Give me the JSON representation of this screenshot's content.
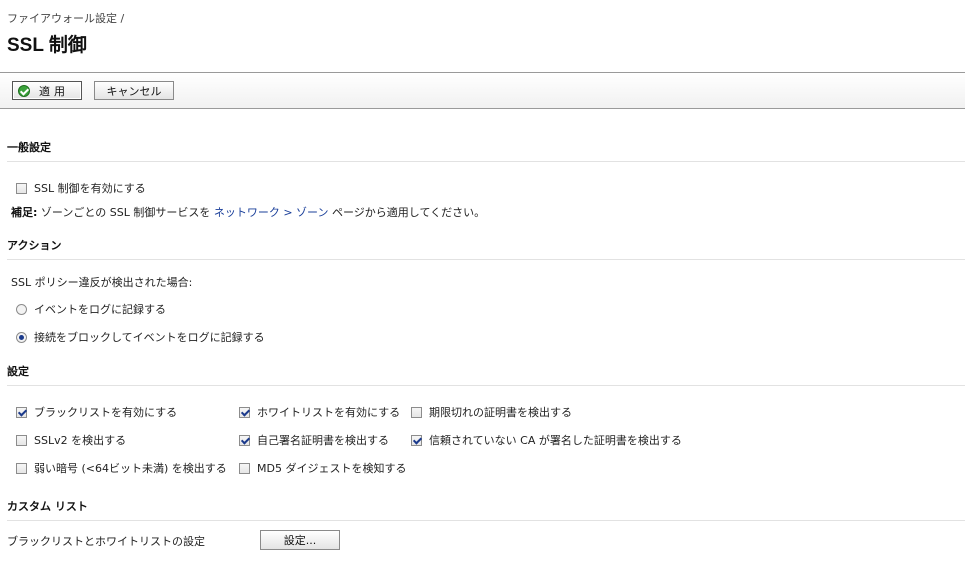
{
  "breadcrumb": "ファイアウォール設定 /",
  "page_title": "SSL 制御",
  "toolbar": {
    "apply_label": "適用",
    "cancel_label": "キャンセル"
  },
  "general": {
    "heading": "一般設定",
    "enable_ssl_label": "SSL 制御を有効にする",
    "enable_ssl_checked": false,
    "note_prefix": "補足:",
    "note_text_1": " ゾーンごとの SSL 制御サービスを ",
    "note_link": "ネットワーク > ゾーン",
    "note_text_2": " ページから適用してください。"
  },
  "action": {
    "heading": "アクション",
    "intro": "SSL ポリシー違反が検出された場合:",
    "options": [
      {
        "label": "イベントをログに記録する",
        "checked": false
      },
      {
        "label": "接続をブロックしてイベントをログに記録する",
        "checked": true
      }
    ]
  },
  "settings": {
    "heading": "設定",
    "checkboxes": [
      {
        "label": "ブラックリストを有効にする",
        "checked": true
      },
      {
        "label": "ホワイトリストを有効にする",
        "checked": true
      },
      {
        "label": "期限切れの証明書を検出する",
        "checked": false
      },
      {
        "label": "SSLv2 を検出する",
        "checked": false
      },
      {
        "label": "自己署名証明書を検出する",
        "checked": true
      },
      {
        "label": "信頼されていない CA が署名した証明書を検出する",
        "checked": true
      },
      {
        "label": "弱い暗号 (<64ビット未満) を検出する",
        "checked": false
      },
      {
        "label": "MD5 ダイジェストを検知する",
        "checked": false
      }
    ]
  },
  "custom": {
    "heading": "カスタム リスト",
    "label": "ブラックリストとホワイトリストの設定",
    "button_label": "設定..."
  }
}
